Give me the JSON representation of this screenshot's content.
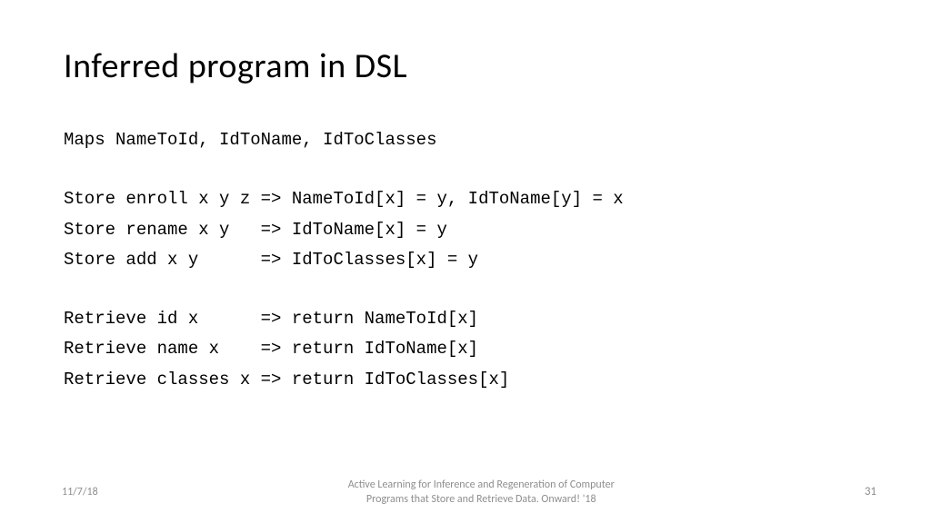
{
  "slide": {
    "title": "Inferred program in DSL",
    "maps_line": "Maps NameToId, IdToName, IdToClasses",
    "store": {
      "l1": "Store enroll x y z => NameToId[x] = y, IdToName[y] = x",
      "l2": "Store rename x y   => IdToName[x] = y",
      "l3": "Store add x y      => IdToClasses[x] = y"
    },
    "retrieve": {
      "l1": "Retrieve id x      => return NameToId[x]",
      "l2": "Retrieve name x    => return IdToName[x]",
      "l3": "Retrieve classes x => return IdToClasses[x]"
    }
  },
  "footer": {
    "date": "11/7/18",
    "ref_line1": "Active Learning for Inference and Regeneration of Computer",
    "ref_line2": "Programs that Store and Retrieve Data. Onward! '18",
    "page": "31"
  }
}
